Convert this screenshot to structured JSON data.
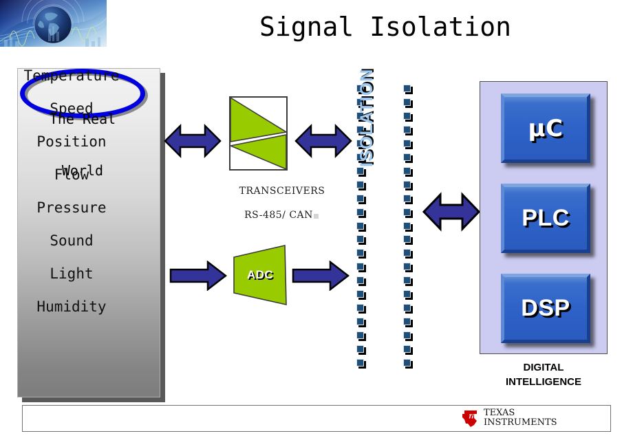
{
  "slide": {
    "title": "Signal Isolation",
    "banner_icon": "globe-waveform-banner-image"
  },
  "real_world_panel": {
    "ellipse_line1": "The Real",
    "ellipse_line2": "World",
    "items": [
      "Temperature",
      "Speed",
      "Position",
      "Flow",
      "Pressure",
      "Sound",
      "Light",
      "Humidity"
    ]
  },
  "transceiver": {
    "label_line1": "TRANSCEIVERS",
    "label_line2": "RS-485/ CAN",
    "icon": "transceiver-triangles-icon"
  },
  "adc": {
    "label": "ADC",
    "icon": "adc-trapezoid-icon"
  },
  "isolation": {
    "label": "ISOLATION",
    "dash_count": 21,
    "icon": "isolation-barrier-icon"
  },
  "digital_intelligence": {
    "caption_line1": "DIGITAL",
    "caption_line2": "INTELLIGENCE",
    "chips": [
      {
        "label": "µC"
      },
      {
        "label": "PLC"
      },
      {
        "label": "DSP"
      }
    ]
  },
  "arrows": {
    "world_to_transceiver": "double-arrow-icon",
    "transceiver_to_isolation": "double-arrow-icon",
    "sensor_to_adc": "right-arrow-icon",
    "adc_to_isolation": "right-arrow-icon",
    "isolation_to_digital": "double-arrow-icon"
  },
  "footer": {
    "logo_mark": "texas-instruments-logo",
    "logo_line1": "TEXAS",
    "logo_line2": "INSTRUMENTS"
  },
  "colors": {
    "arrow_blue": "#333399",
    "chip_blue": "#2f63c7",
    "panel_lavender": "#ccccf2",
    "green": "#99cc00",
    "isolation_dash": "#1f4e79",
    "isolation_text": "#9ec8f0",
    "ellipse_blue": "#0000e0",
    "ti_red": "#cc0000"
  }
}
